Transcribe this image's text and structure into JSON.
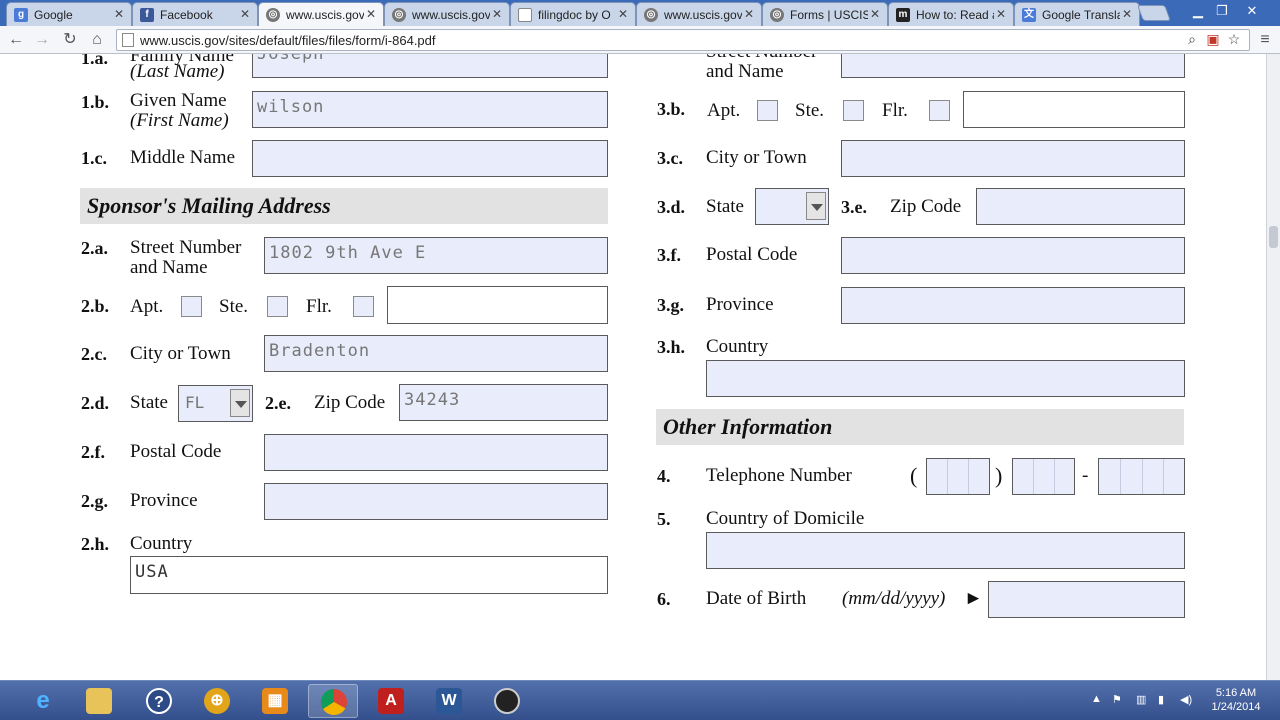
{
  "browser": {
    "tabs": [
      {
        "label": "Google",
        "icon": "google-icon"
      },
      {
        "label": "Facebook",
        "icon": "facebook-icon"
      },
      {
        "label": "www.uscis.gov",
        "icon": "uscis-icon"
      },
      {
        "label": "www.uscis.gov",
        "icon": "uscis-icon"
      },
      {
        "label": "filingdoc by O",
        "icon": "document-icon"
      },
      {
        "label": "www.uscis.gov",
        "icon": "uscis-icon"
      },
      {
        "label": "Forms | USCIS",
        "icon": "uscis-icon"
      },
      {
        "label": "How to: Read a",
        "icon": "medium-icon"
      },
      {
        "label": "Google Transla",
        "icon": "translate-icon"
      }
    ],
    "url": "www.uscis.gov/sites/default/files/files/form/i-864.pdf"
  },
  "form": {
    "left": {
      "q1a_num": "1.a.",
      "q1a_label": "Family Name",
      "q1a_sub": "(Last Name)",
      "q1a_value": "Joseph",
      "q1b_num": "1.b.",
      "q1b_label": "Given Name",
      "q1b_sub": "(First Name)",
      "q1b_value": "wilson",
      "q1c_num": "1.c.",
      "q1c_label": "Middle Name",
      "q1c_value": "",
      "section_title": "Sponsor's Mailing Address",
      "q2a_num": "2.a.",
      "q2a_label1": "Street Number",
      "q2a_label2": "and Name",
      "q2a_value": "1802 9th Ave E",
      "q2b_num": "2.b.",
      "apt": "Apt.",
      "ste": "Ste.",
      "flr": "Flr.",
      "q2b_value": "",
      "q2c_num": "2.c.",
      "q2c_label": "City or Town",
      "q2c_value": "Bradenton",
      "q2d_num": "2.d.",
      "q2d_label": "State",
      "q2d_value": "FL",
      "q2e_num": "2.e.",
      "q2e_label": "Zip Code",
      "q2e_value": "34243",
      "q2f_num": "2.f.",
      "q2f_label": "Postal Code",
      "q2f_value": "",
      "q2g_num": "2.g.",
      "q2g_label": "Province",
      "q2g_value": "",
      "q2h_num": "2.h.",
      "q2h_label": "Country",
      "q2h_value": "USA"
    },
    "right": {
      "q3a_label1": "Street Number",
      "q3a_label2": "and Name",
      "q3a_value": "",
      "q3b_num": "3.b.",
      "apt": "Apt.",
      "ste": "Ste.",
      "flr": "Flr.",
      "q3b_value": "",
      "q3c_num": "3.c.",
      "q3c_label": "City or Town",
      "q3c_value": "",
      "q3d_num": "3.d.",
      "q3d_label": "State",
      "q3d_value": "",
      "q3e_num": "3.e.",
      "q3e_label": "Zip Code",
      "q3e_value": "",
      "q3f_num": "3.f.",
      "q3f_label": "Postal Code",
      "q3f_value": "",
      "q3g_num": "3.g.",
      "q3g_label": "Province",
      "q3g_value": "",
      "q3h_num": "3.h.",
      "q3h_label": "Country",
      "q3h_value": "",
      "section_title": "Other Information",
      "q4_num": "4.",
      "q4_label": "Telephone Number",
      "paren_open": "(",
      "paren_close": ")",
      "dash": "-",
      "q5_num": "5.",
      "q5_label": "Country of Domicile",
      "q5_value": "",
      "q6_num": "6.",
      "q6_label": "Date of Birth",
      "q6_hint": "(mm/dd/yyyy)",
      "q6_arrow": "►",
      "q6_value": ""
    }
  },
  "taskbar": {
    "apps": [
      "internet-explorer-icon",
      "file-explorer-icon",
      "help-icon",
      "globe-icon",
      "apps-icon",
      "chrome-icon",
      "adobe-reader-icon",
      "word-icon",
      "camera-icon"
    ],
    "time": "5:16 AM",
    "date": "1/24/2014"
  },
  "colors": {
    "field_bg": "#e9ecfa",
    "section_bg": "#e2e2e2",
    "taskbar": "#3d5a96"
  }
}
